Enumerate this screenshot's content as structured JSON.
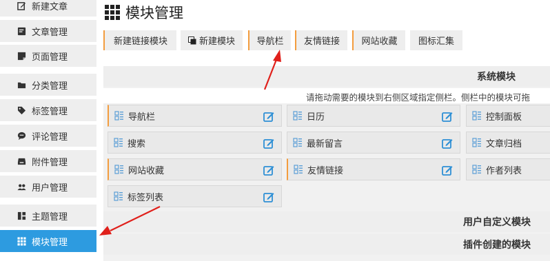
{
  "sidebar": {
    "items": [
      {
        "label": "新建文章",
        "icon": "edit-icon"
      },
      {
        "label": "文章管理",
        "icon": "article-icon"
      },
      {
        "label": "页面管理",
        "icon": "page-icon"
      },
      {
        "label": "分类管理",
        "icon": "folder-icon"
      },
      {
        "label": "标签管理",
        "icon": "tag-icon"
      },
      {
        "label": "评论管理",
        "icon": "comment-icon"
      },
      {
        "label": "附件管理",
        "icon": "inbox-icon"
      },
      {
        "label": "用户管理",
        "icon": "users-icon"
      },
      {
        "label": "主题管理",
        "icon": "theme-icon"
      },
      {
        "label": "模块管理",
        "icon": "grid-icon",
        "active": true
      }
    ]
  },
  "page": {
    "title": "模块管理",
    "title_icon": "grid-icon"
  },
  "toolbar": {
    "buttons": [
      {
        "label": "新建链接模块"
      },
      {
        "label": "新建模块",
        "icon": "copy-icon"
      },
      {
        "label": "导航栏"
      },
      {
        "label": "友情链接"
      },
      {
        "label": "网站收藏"
      },
      {
        "label": "图标汇集"
      }
    ]
  },
  "system_modules": {
    "header": "系统模块",
    "hint": "请拖动需要的模块到右侧区域指定侧栏。侧栏中的模块可拖",
    "widgets": [
      {
        "label": "导航栏"
      },
      {
        "label": "日历"
      },
      {
        "label": "控制面板"
      },
      {
        "label": "搜索"
      },
      {
        "label": "最新留言"
      },
      {
        "label": "文章归档"
      },
      {
        "label": "网站收藏"
      },
      {
        "label": "友情链接"
      },
      {
        "label": "作者列表"
      },
      {
        "label": "标签列表"
      }
    ]
  },
  "user_modules": {
    "header": "用户自定义模块"
  },
  "plugin_modules": {
    "header": "插件创建的模块"
  },
  "colors": {
    "accent": "#f39c3d",
    "active": "#2d9be0",
    "arrow": "#e0201b",
    "edit_icon": "#2d8fd5"
  }
}
